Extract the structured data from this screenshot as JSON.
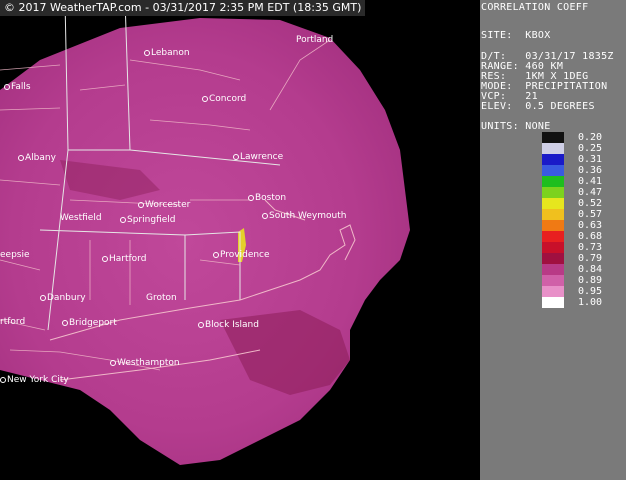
{
  "banner": "© 2017 WeatherTAP.com - 03/31/2017  2:35 PM EDT (18:35 GMT)",
  "panel": {
    "product": "CORRELATION COEFF",
    "site": "SITE:  KBOX",
    "dt": "D/T:   03/31/17 1835Z",
    "range": "RANGE: 460 KM",
    "res": "RES:   1KM X 1DEG",
    "mode": "MODE:  PRECIPITATION",
    "vcp": "VCP:   21",
    "elev": "ELEV:  0.5 DEGREES",
    "units": "UNITS: NONE"
  },
  "scale": {
    "values": [
      "0.20",
      "0.25",
      "0.31",
      "0.36",
      "0.41",
      "0.47",
      "0.52",
      "0.57",
      "0.63",
      "0.68",
      "0.73",
      "0.79",
      "0.84",
      "0.89",
      "0.95",
      "1.00"
    ],
    "colors": [
      "#111111",
      "#cfcfe6",
      "#1a1ac8",
      "#3a5ae0",
      "#1ebe1e",
      "#7cd21e",
      "#e6e61e",
      "#f0c01e",
      "#f07a14",
      "#e82020",
      "#c8102a",
      "#a01040",
      "#b83a86",
      "#d060a8",
      "#e890c8",
      "#ffffff"
    ]
  },
  "cities": [
    {
      "name": "Portland",
      "dot": false
    },
    {
      "name": "Lebanon",
      "dot": true
    },
    {
      "name": "Falls",
      "dot": true
    },
    {
      "name": "Concord",
      "dot": true
    },
    {
      "name": "Albany",
      "dot": true
    },
    {
      "name": "Lawrence",
      "dot": true
    },
    {
      "name": "Worcester",
      "dot": true
    },
    {
      "name": "Boston",
      "dot": true
    },
    {
      "name": "Westfield",
      "dot": false
    },
    {
      "name": "Springfield",
      "dot": true
    },
    {
      "name": "South Weymouth",
      "dot": true
    },
    {
      "name": "eepsie",
      "dot": false
    },
    {
      "name": "Hartford",
      "dot": true
    },
    {
      "name": "Providence",
      "dot": true
    },
    {
      "name": "Danbury",
      "dot": true
    },
    {
      "name": "Groton",
      "dot": false
    },
    {
      "name": "Block Island",
      "dot": true
    },
    {
      "name": "rtford",
      "dot": false
    },
    {
      "name": "Bridgeport",
      "dot": true
    },
    {
      "name": "Westhampton",
      "dot": true
    },
    {
      "name": "New York City",
      "dot": true
    }
  ]
}
